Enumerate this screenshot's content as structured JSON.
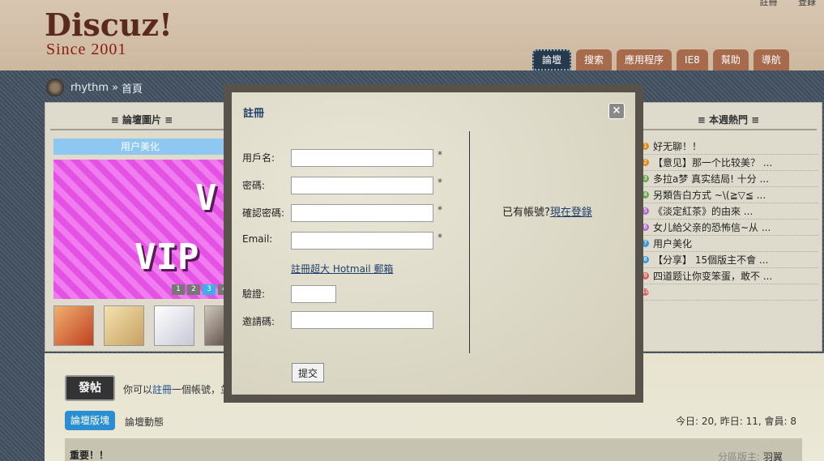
{
  "header": {
    "logo": "Discuz!",
    "since": "Since 2001",
    "top_links": [
      "註冊",
      "登錄"
    ],
    "nav_tabs": [
      "論壇",
      "搜索",
      "應用程序",
      "IE8",
      "幫助",
      "導航"
    ]
  },
  "breadcrumb": {
    "site": "rhythm",
    "separator": "»",
    "page": "首頁"
  },
  "left_panel": {
    "title": "≡ 論壇圖片 ≡",
    "banner_label": "用户美化",
    "banner_art_v": "V",
    "banner_art_vip": "VIP",
    "pager": [
      "1",
      "2",
      "3",
      "4"
    ]
  },
  "right_panel": {
    "title": "≡ 本週熱門 ≡",
    "items": [
      {
        "text": "好无聊！！",
        "color": "#e08a20"
      },
      {
        "text": "【意见】那一个比较美？ ...",
        "color": "#e08a20"
      },
      {
        "text": "多拉a梦 真实结局! 十分 ...",
        "color": "#6aa84f"
      },
      {
        "text": "另類告白方式 ~\\(≧▽≦ ...",
        "color": "#6aa84f"
      },
      {
        "text": "《淡定紅茶》的由來 ...",
        "color": "#b06ad0"
      },
      {
        "text": "女儿給父亲的恐怖信~从 ...",
        "color": "#b06ad0"
      },
      {
        "text": "用户美化",
        "color": "#3a9ad9"
      },
      {
        "text": "【分享】 15個版主不會 ...",
        "color": "#3a9ad9"
      },
      {
        "text": "四道题让你变笨蛋，敢不 ...",
        "color": "#e06060"
      },
      {
        "text": "",
        "color": "#e06060"
      }
    ]
  },
  "forum": {
    "post_button": "發帖",
    "reg_hint_prefix": "你可以",
    "reg_hint_link": "註冊",
    "reg_hint_suffix": "一個帳號，並",
    "tab_active": "論壇版塊",
    "tab_other": "論壇動態",
    "stats": "今日: 20, 昨日: 11, 會員: 8",
    "category_title": "重要！！",
    "moderator_label": "分區版主:",
    "moderator_name": "羽翼"
  },
  "modal": {
    "title": "註冊",
    "close_label": "×",
    "fields": {
      "username_label": "用戶名:",
      "password_label": "密碼:",
      "confirm_label": "確認密碼:",
      "email_label": "Email:",
      "captcha_label": "驗證:",
      "invite_label": "邀請碼:",
      "required_mark": "*"
    },
    "hotmail_link": "註冊超大 Hotmail 郵箱",
    "submit_label": "提交",
    "login_prompt": "已有帳號?",
    "login_link": "現在登錄"
  }
}
